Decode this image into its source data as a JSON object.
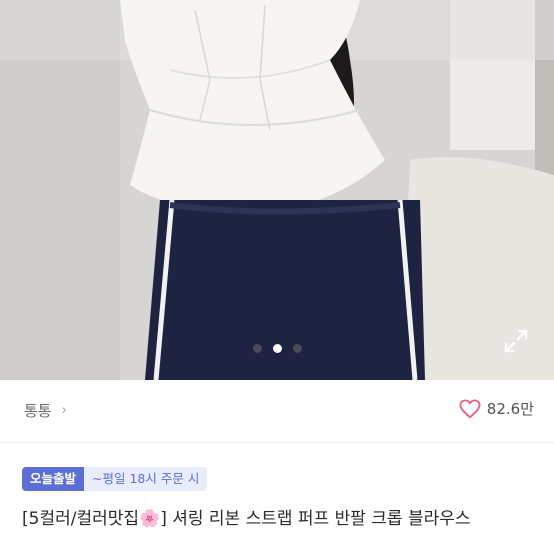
{
  "product_image": {
    "description_icon": "photo",
    "carousel": {
      "total": 3,
      "active_index": 1
    },
    "expand_icon": "expand-icon"
  },
  "seller": {
    "name": "통통"
  },
  "like": {
    "count": "82.6만"
  },
  "badges": {
    "primary": "오늘출발",
    "secondary": "~평일 18시 주문 시"
  },
  "title": {
    "before_emoji": "[5컬러/컬러맛집",
    "emoji_icon": "flower-emoji",
    "after_emoji": "] 셔링 리본 스트랩 퍼프 반팔 크롭 블라우스"
  },
  "colors": {
    "accent": "#5b6fd4",
    "like": "#e8607a"
  }
}
